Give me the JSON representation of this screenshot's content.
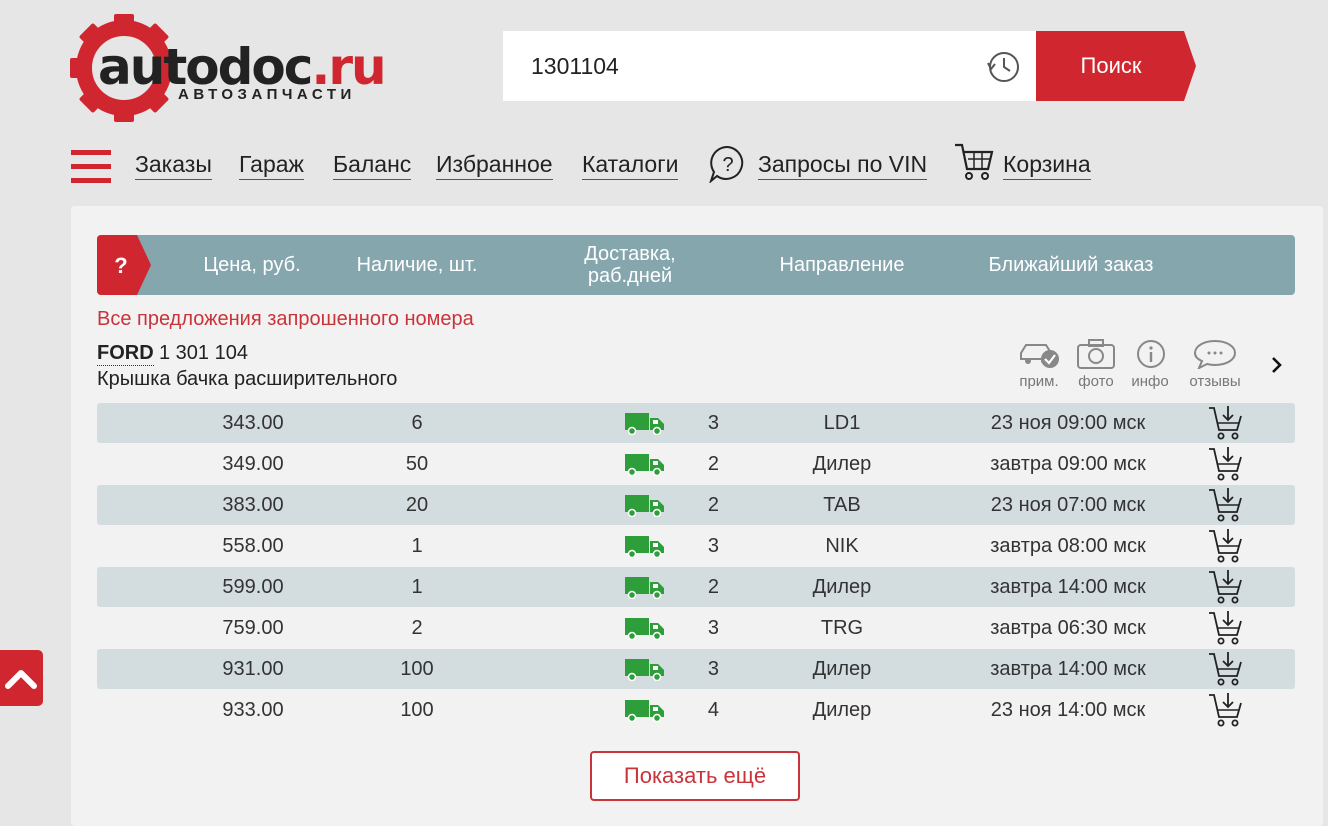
{
  "brand": {
    "logo_text": "autodoc",
    "logo_ru": ".ru",
    "logo_sub": "АВТОЗАПЧАСТИ",
    "accent": "#d0262f"
  },
  "search": {
    "value": "1301104",
    "button_label": "Поиск"
  },
  "nav": {
    "orders": "Заказы",
    "garage": "Гараж",
    "balance": "Баланс",
    "favorites": "Избранное",
    "catalogs": "Каталоги",
    "vin": "Запросы по VIN",
    "cart": "Корзина"
  },
  "table": {
    "help": "?",
    "headers": {
      "price": "Цена, руб.",
      "stock": "Наличие, шт.",
      "delivery_1": "Доставка,",
      "delivery_2": "раб.дней",
      "direction": "Направление",
      "nearest": "Ближайший заказ"
    },
    "all_offers": "Все предложения запрошенного номера",
    "product": {
      "brand": "FORD",
      "number": "1 301 104",
      "description": "Крышка бачка расширительного"
    },
    "product_actions": {
      "fit": "прим.",
      "photo": "фото",
      "info": "инфо",
      "reviews": "отзывы"
    },
    "rows": [
      {
        "price": "343.00",
        "qty": "6",
        "days": "3",
        "direction": "LD1",
        "nearest": "23 ноя 09:00 мск"
      },
      {
        "price": "349.00",
        "qty": "50",
        "days": "2",
        "direction": "Дилер",
        "nearest": "завтра 09:00 мск"
      },
      {
        "price": "383.00",
        "qty": "20",
        "days": "2",
        "direction": "TAB",
        "nearest": "23 ноя 07:00 мск"
      },
      {
        "price": "558.00",
        "qty": "1",
        "days": "3",
        "direction": "NIK",
        "nearest": "завтра 08:00 мск"
      },
      {
        "price": "599.00",
        "qty": "1",
        "days": "2",
        "direction": "Дилер",
        "nearest": "завтра 14:00 мск"
      },
      {
        "price": "759.00",
        "qty": "2",
        "days": "3",
        "direction": "TRG",
        "nearest": "завтра 06:30 мск"
      },
      {
        "price": "931.00",
        "qty": "100",
        "days": "3",
        "direction": "Дилер",
        "nearest": "завтра 14:00 мск"
      },
      {
        "price": "933.00",
        "qty": "100",
        "days": "4",
        "direction": "Дилер",
        "nearest": "23 ноя 14:00 мск"
      }
    ],
    "show_more": "Показать ещё"
  },
  "icons": {
    "truck": "truck-icon",
    "cart": "add-to-cart-icon",
    "scroll_top": "chevron-up-icon"
  }
}
